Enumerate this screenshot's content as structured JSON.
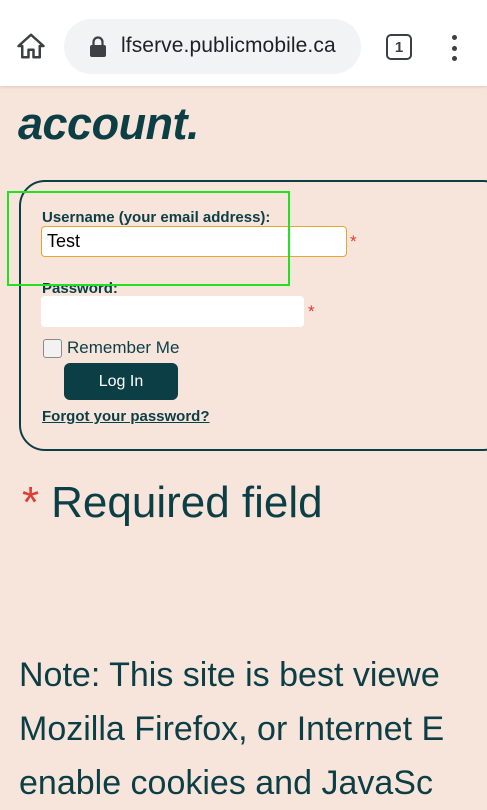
{
  "browser": {
    "url": "lfserve.publicmobile.ca",
    "tab_count": "1"
  },
  "page": {
    "heading": "account.",
    "username_label": "Username (your email address):",
    "username_value": "Test",
    "password_label": "Password:",
    "password_value": "",
    "required_marker": "*",
    "remember_label": "Remember Me",
    "login_button": "Log In",
    "forgot_link": "Forgot your password?",
    "required_note": "Required field",
    "note_lines": [
      "Note: This site is best viewe",
      "Mozilla Firefox, or Internet E",
      "enable cookies and JavaSc"
    ]
  },
  "colors": {
    "background": "#f7e5dc",
    "brand": "#0c3e45",
    "required": "#e03c31",
    "focus_border": "#e6a630",
    "highlight": "#22e022"
  },
  "icons": {
    "home": "home-icon",
    "lock": "lock-icon",
    "tabs": "tabs-icon",
    "menu": "more-vert-icon"
  }
}
